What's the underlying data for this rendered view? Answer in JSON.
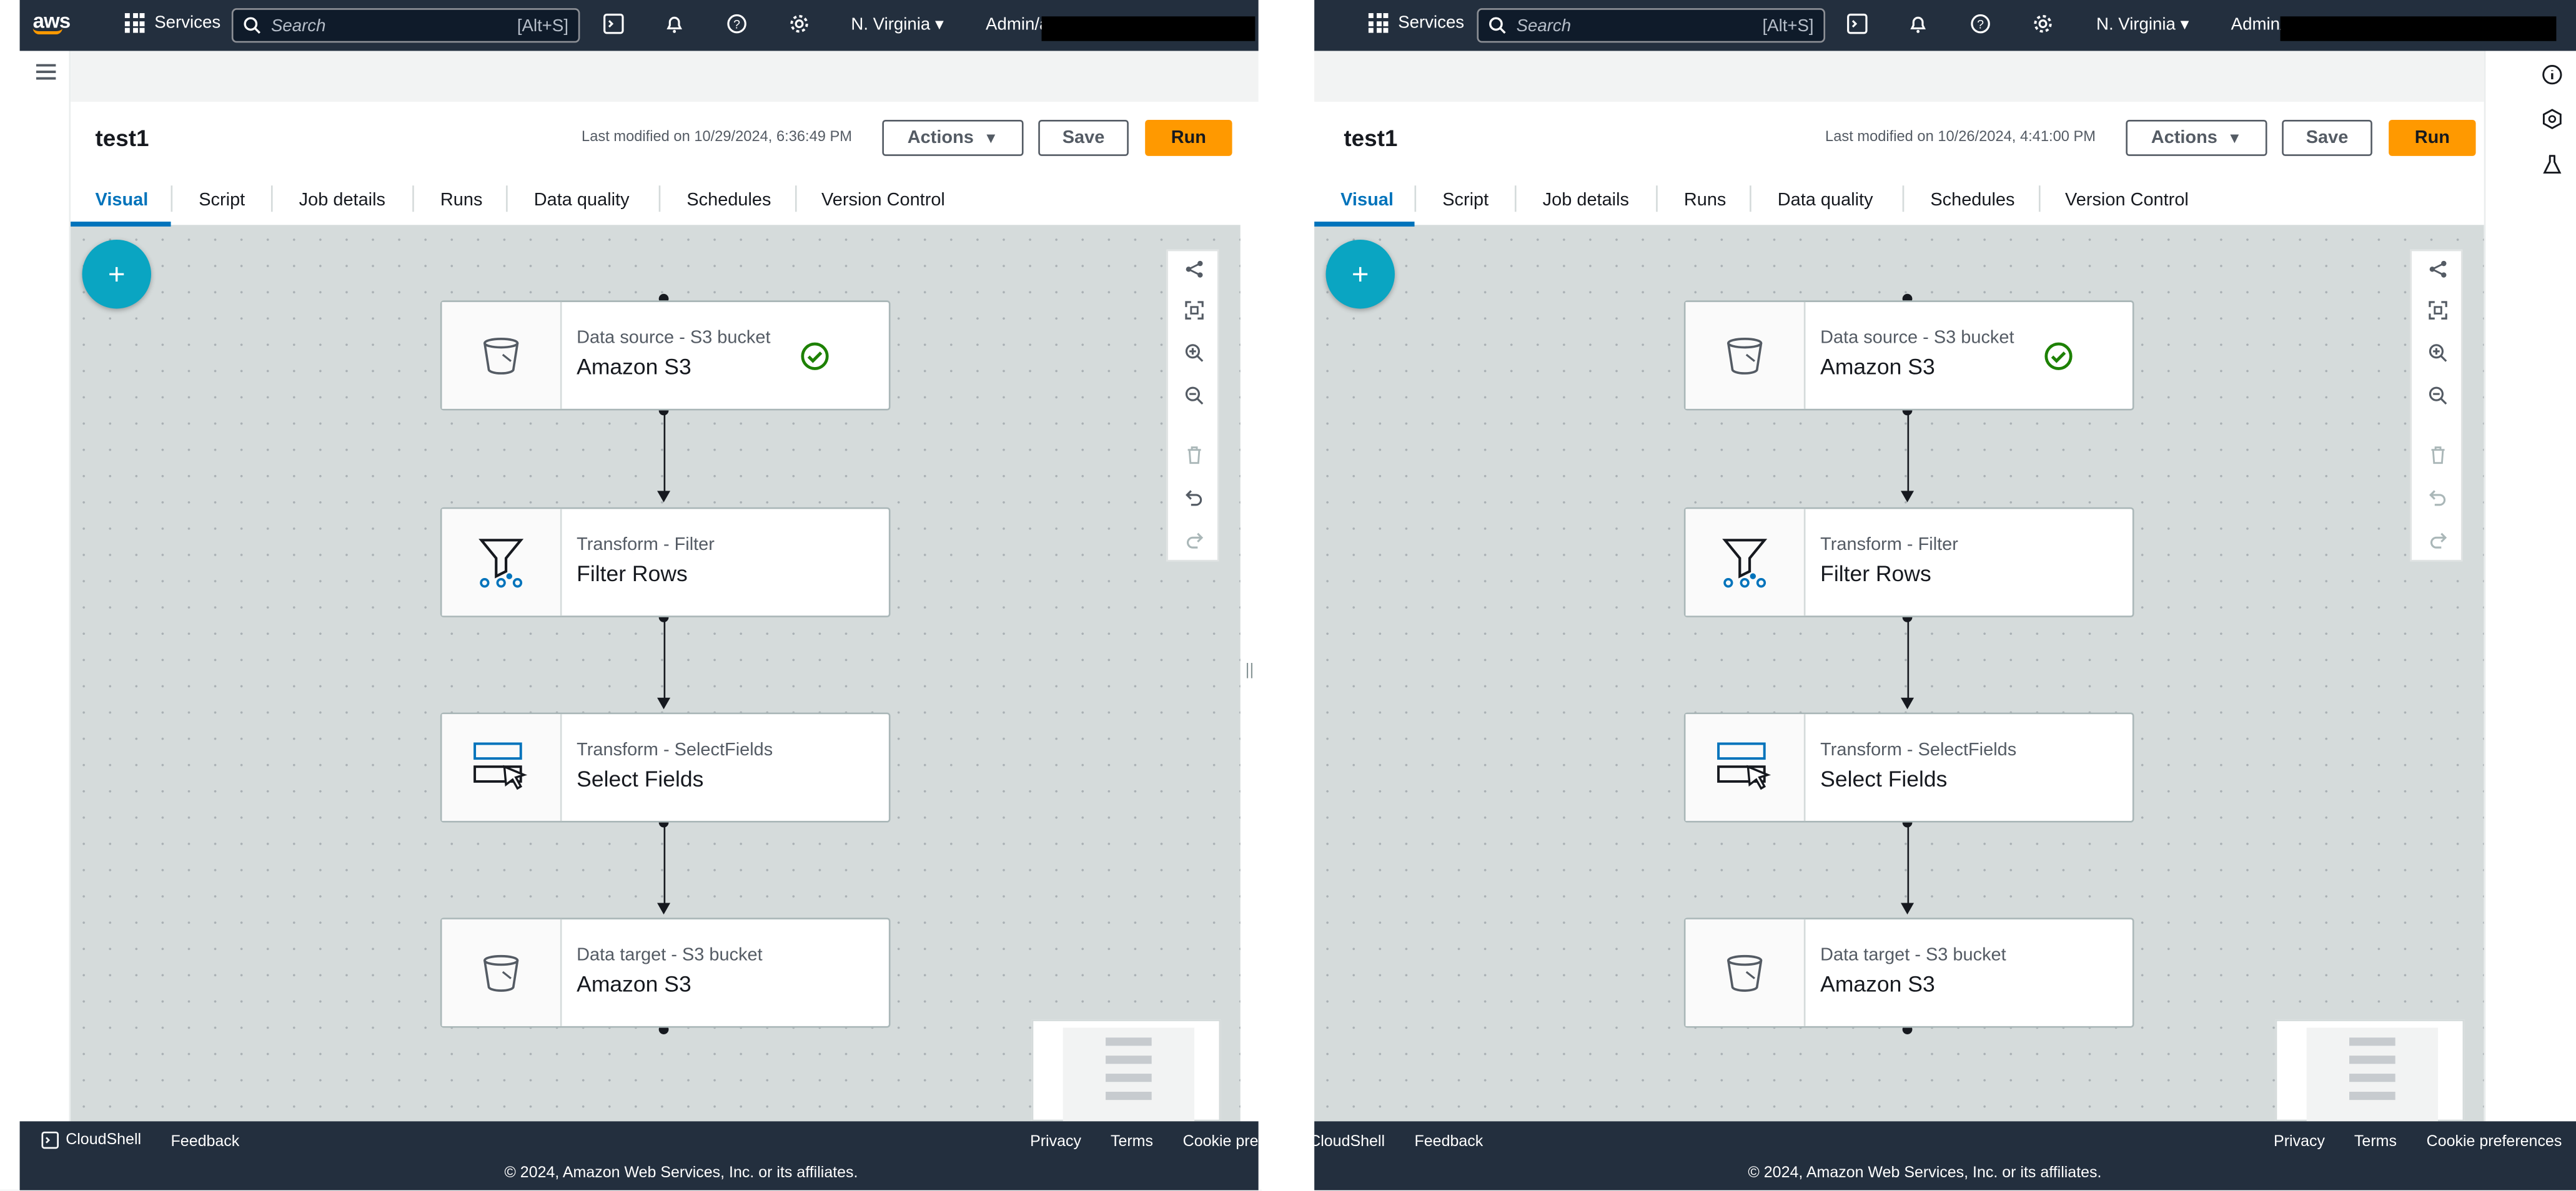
{
  "left": {
    "nav": {
      "services_label": "Services",
      "search_placeholder": "Search",
      "search_shortcut": "[Alt+S]",
      "region": "N. Virginia",
      "user": "Admin/a"
    },
    "job_title": "test1",
    "last_modified": "Last modified on 10/29/2024, 6:36:49 PM",
    "actions_label": "Actions",
    "save_label": "Save",
    "run_label": "Run",
    "tabs": [
      "Visual",
      "Script",
      "Job details",
      "Runs",
      "Data quality",
      "Schedules",
      "Version Control"
    ],
    "nodes": [
      {
        "sub": "Data source - S3 bucket",
        "main": "Amazon S3",
        "icon": "bucket-icon",
        "status": "check-circle-icon"
      },
      {
        "sub": "Transform - Filter",
        "main": "Filter Rows",
        "icon": "filter-icon"
      },
      {
        "sub": "Transform - SelectFields",
        "main": "Select Fields",
        "icon": "select-fields-icon"
      },
      {
        "sub": "Data target - S3 bucket",
        "main": "Amazon S3",
        "icon": "bucket-icon"
      }
    ],
    "footer": {
      "cloudshell": "CloudShell",
      "feedback": "Feedback",
      "privacy": "Privacy",
      "terms": "Terms",
      "cookie": "Cookie pref",
      "copyright": "© 2024, Amazon Web Services, Inc. or its affiliates."
    }
  },
  "right": {
    "nav": {
      "services_label": "Services",
      "search_placeholder": "Search",
      "search_shortcut": "[Alt+S]",
      "region": "N. Virginia",
      "user": "Admin/"
    },
    "job_title": "test1",
    "last_modified": "Last modified on 10/26/2024, 4:41:00 PM",
    "actions_label": "Actions",
    "save_label": "Save",
    "run_label": "Run",
    "tabs": [
      "Visual",
      "Script",
      "Job details",
      "Runs",
      "Data quality",
      "Schedules",
      "Version Control"
    ],
    "nodes": [
      {
        "sub": "Data source - S3 bucket",
        "main": "Amazon S3",
        "icon": "bucket-icon",
        "status": "check-circle-icon"
      },
      {
        "sub": "Transform - Filter",
        "main": "Filter Rows",
        "icon": "filter-icon"
      },
      {
        "sub": "Transform - SelectFields",
        "main": "Select Fields",
        "icon": "select-fields-icon"
      },
      {
        "sub": "Data target - S3 bucket",
        "main": "Amazon S3",
        "icon": "bucket-icon"
      }
    ],
    "footer": {
      "cloudshell": "CloudShell",
      "feedback": "Feedback",
      "privacy": "Privacy",
      "terms": "Terms",
      "cookie": "Cookie preferences",
      "copyright": "© 2024, Amazon Web Services, Inc. or its affiliates."
    }
  },
  "colors": {
    "nav_bg": "#232f3e",
    "run_button": "#ff9900",
    "active_tab": "#0073bb",
    "add_node": "#0aa5c2",
    "success": "#1d8102"
  }
}
